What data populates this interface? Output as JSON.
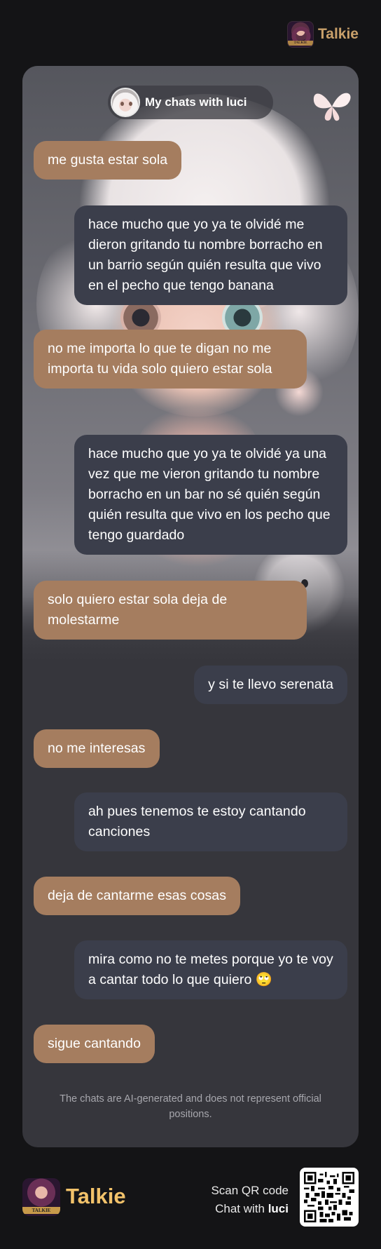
{
  "brand": {
    "name": "Talkie",
    "logo_text": "TALKIE"
  },
  "chat": {
    "title": "My chats with luci",
    "messages": [
      {
        "role": "character",
        "text": "me gusta estar sola"
      },
      {
        "role": "user",
        "text": "hace mucho que yo ya te olvidé me dieron gritando tu nombre borracho en un barrio según quién resulta que vivo en el pecho que tengo banana"
      },
      {
        "role": "character",
        "text": "no me importa lo que te digan no me importa tu vida solo quiero estar sola"
      },
      {
        "role": "user",
        "text": "hace mucho que yo ya te olvidé ya una vez que me vieron gritando tu nombre borracho en un bar no sé quién según quién resulta que vivo en los pecho que tengo guardado"
      },
      {
        "role": "character",
        "text": "solo quiero estar sola deja de molestarme"
      },
      {
        "role": "user",
        "text": "y si te llevo serenata"
      },
      {
        "role": "character",
        "text": "no me interesas"
      },
      {
        "role": "user",
        "text": "ah pues tenemos te estoy cantando canciones"
      },
      {
        "role": "character",
        "text": "deja de cantarme esas cosas"
      },
      {
        "role": "user",
        "text": "mira como no te metes porque yo te voy a cantar todo lo que quiero 🙄"
      },
      {
        "role": "character",
        "text": "sigue cantando"
      }
    ],
    "disclaimer": "The chats are AI-generated and does not represent official positions."
  },
  "footer": {
    "scan_line": "Scan QR code",
    "chat_with_prefix": "Chat with",
    "character_name": "luci"
  },
  "colors": {
    "character_bubble": "#a57d5f",
    "user_bubble": "#3b3e4b",
    "brand_gold": "#f2c26a",
    "page_bg": "#141416",
    "card_bg": "#36363c"
  },
  "icons": {
    "butterfly": "butterfly-icon",
    "avatar": "character-avatar",
    "qr": "qr-code"
  }
}
